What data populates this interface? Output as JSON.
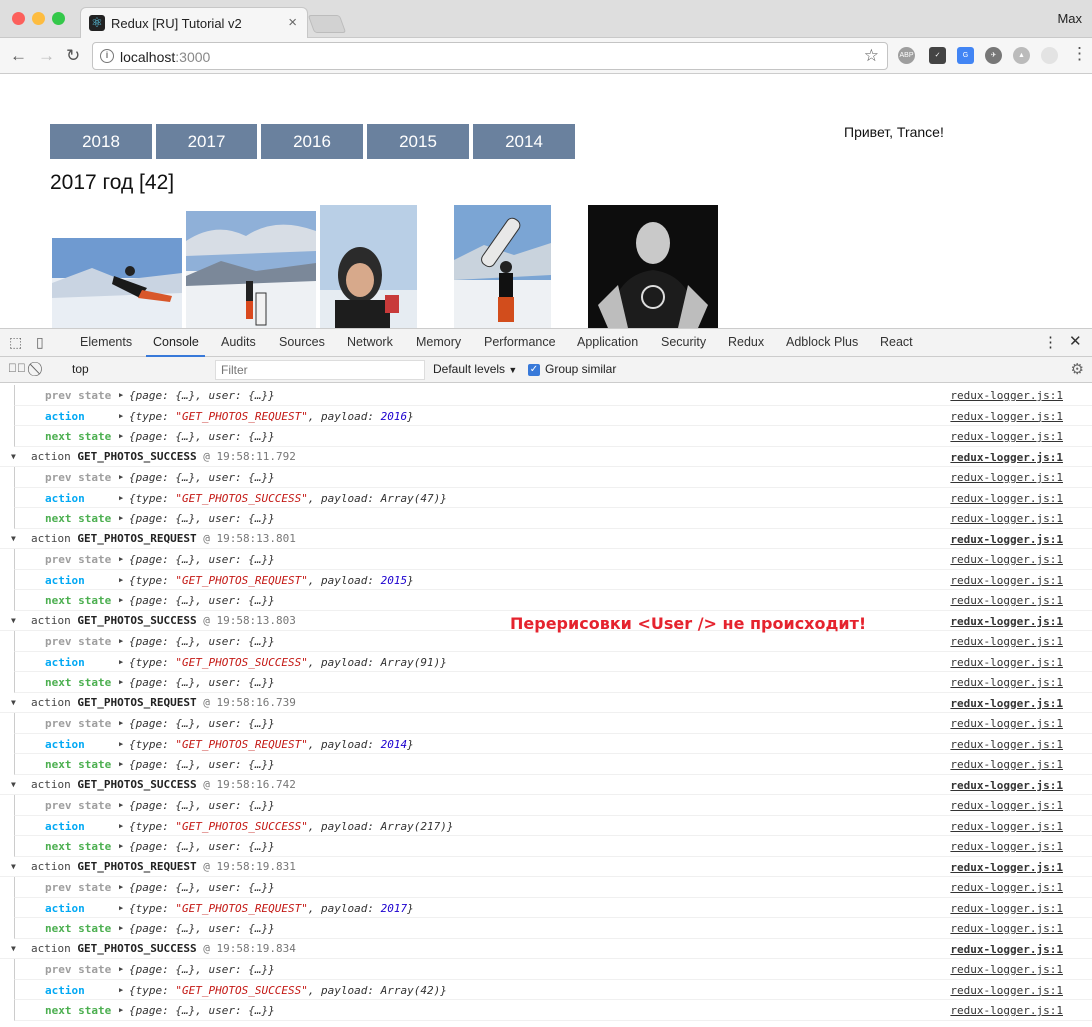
{
  "browser": {
    "tab_title": "Redux [RU] Tutorial v2",
    "profile": "Max",
    "url_host": "localhost",
    "url_port": ":3000"
  },
  "page": {
    "years": [
      "2018",
      "2017",
      "2016",
      "2015",
      "2014"
    ],
    "heading": "2017 год [42]",
    "greeting": "Привет, Trance!"
  },
  "devtools": {
    "tabs": [
      "Elements",
      "Console",
      "Audits",
      "Sources",
      "Network",
      "Memory",
      "Performance",
      "Application",
      "Security",
      "Redux",
      "Adblock Plus",
      "React"
    ],
    "active_tab": "Console",
    "context": "top",
    "filter_placeholder": "Filter",
    "levels": "Default levels",
    "group_similar": "Group similar"
  },
  "log": {
    "source": "redux-logger.js:1",
    "leading": [
      {
        "kind": "prev",
        "label": "prev state",
        "text": "{page: {…}, user: {…}}"
      },
      {
        "kind": "act",
        "label": "action",
        "type": "\"GET_PHOTOS_REQUEST\"",
        "payload": "2016",
        "payload_num": true
      },
      {
        "kind": "next",
        "label": "next state",
        "text": "{page: {…}, user: {…}}"
      }
    ],
    "groups": [
      {
        "action": "GET_PHOTOS_SUCCESS",
        "time": "@ 19:58:11.792",
        "type": "\"GET_PHOTOS_SUCCESS\"",
        "payload": "Array(47)",
        "payload_num": false
      },
      {
        "action": "GET_PHOTOS_REQUEST",
        "time": "@ 19:58:13.801",
        "type": "\"GET_PHOTOS_REQUEST\"",
        "payload": "2015",
        "payload_num": true
      },
      {
        "action": "GET_PHOTOS_SUCCESS",
        "time": "@ 19:58:13.803",
        "type": "\"GET_PHOTOS_SUCCESS\"",
        "payload": "Array(91)",
        "payload_num": false
      },
      {
        "action": "GET_PHOTOS_REQUEST",
        "time": "@ 19:58:16.739",
        "type": "\"GET_PHOTOS_REQUEST\"",
        "payload": "2014",
        "payload_num": true
      },
      {
        "action": "GET_PHOTOS_SUCCESS",
        "time": "@ 19:58:16.742",
        "type": "\"GET_PHOTOS_SUCCESS\"",
        "payload": "Array(217)",
        "payload_num": false
      },
      {
        "action": "GET_PHOTOS_REQUEST",
        "time": "@ 19:58:19.831",
        "type": "\"GET_PHOTOS_REQUEST\"",
        "payload": "2017",
        "payload_num": true
      },
      {
        "action": "GET_PHOTOS_SUCCESS",
        "time": "@ 19:58:19.834",
        "type": "\"GET_PHOTOS_SUCCESS\"",
        "payload": "Array(42)",
        "payload_num": false
      }
    ],
    "prev_label": "prev state",
    "action_label": "action",
    "next_label": "next state",
    "group_prefix": "action",
    "state_text": "{page: {…}, user: {…}}",
    "type_key": "{type: ",
    "payload_key": ", payload: ",
    "close": "}"
  },
  "annotation": "Перерисовки <User /> не происходит!"
}
